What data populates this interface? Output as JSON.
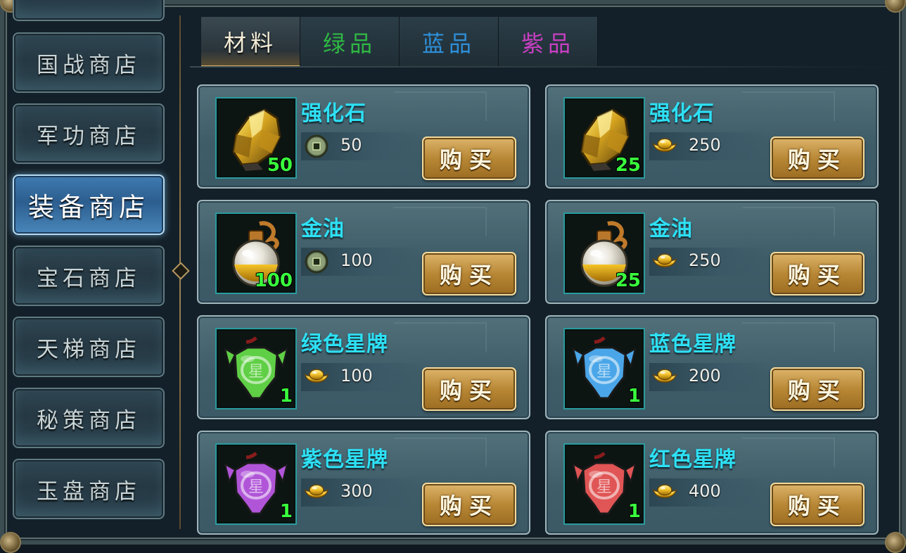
{
  "sidebar": {
    "items": [
      {
        "label": "国战商店"
      },
      {
        "label": "军功商店"
      },
      {
        "label": "装备商店"
      },
      {
        "label": "宝石商店"
      },
      {
        "label": "天梯商店"
      },
      {
        "label": "秘策商店"
      },
      {
        "label": "玉盘商店"
      }
    ],
    "active_index": 2
  },
  "tabs": [
    {
      "label": "材料",
      "color": "#f3ecd7"
    },
    {
      "label": "绿品",
      "color": "#2fb843"
    },
    {
      "label": "蓝品",
      "color": "#2e8fd8"
    },
    {
      "label": "紫品",
      "color": "#c83fc2"
    }
  ],
  "active_tab": 0,
  "buy_label": "购买",
  "items": [
    {
      "name": "强化石",
      "qty": "50",
      "price": "50",
      "currency_icon": "copper-coin-icon",
      "item_icon": "strengthen-stone-icon"
    },
    {
      "name": "强化石",
      "qty": "25",
      "price": "250",
      "currency_icon": "gold-ingot-icon",
      "item_icon": "strengthen-stone-icon"
    },
    {
      "name": "金油",
      "qty": "100",
      "price": "100",
      "currency_icon": "copper-coin-icon",
      "item_icon": "gold-oil-icon"
    },
    {
      "name": "金油",
      "qty": "25",
      "price": "250",
      "currency_icon": "gold-ingot-icon",
      "item_icon": "gold-oil-icon"
    },
    {
      "name": "绿色星牌",
      "qty": "1",
      "price": "100",
      "currency_icon": "gold-ingot-icon",
      "item_icon": "green-star-token-icon",
      "token_color": "#5fcf45"
    },
    {
      "name": "蓝色星牌",
      "qty": "1",
      "price": "200",
      "currency_icon": "gold-ingot-icon",
      "item_icon": "blue-star-token-icon",
      "token_color": "#4aa6e8"
    },
    {
      "name": "紫色星牌",
      "qty": "1",
      "price": "300",
      "currency_icon": "gold-ingot-icon",
      "item_icon": "purple-star-token-icon",
      "token_color": "#b055d8"
    },
    {
      "name": "红色星牌",
      "qty": "1",
      "price": "400",
      "currency_icon": "gold-ingot-icon",
      "item_icon": "red-star-token-icon",
      "token_color": "#e05555"
    }
  ]
}
